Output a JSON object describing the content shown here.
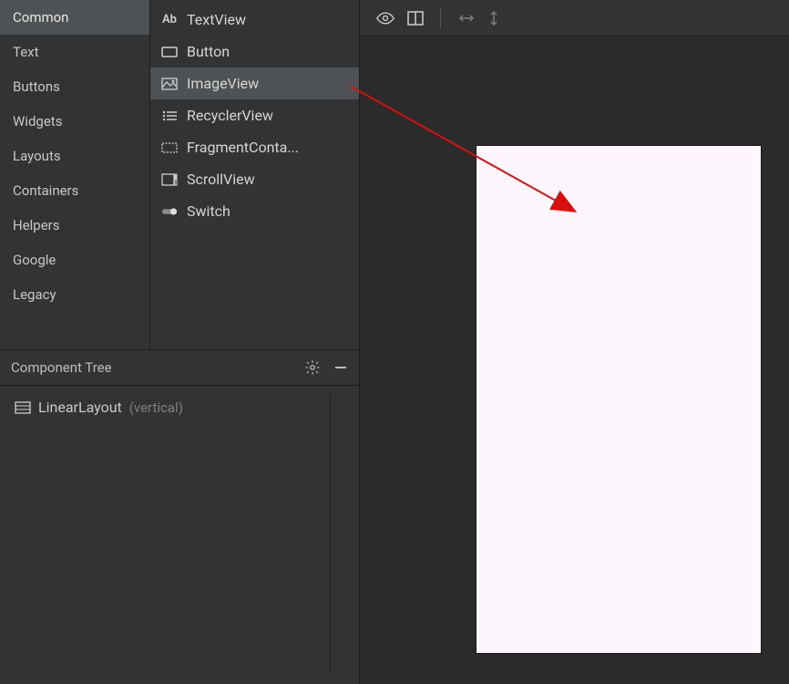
{
  "palette": {
    "categories": [
      {
        "label": "Common",
        "selected": true
      },
      {
        "label": "Text"
      },
      {
        "label": "Buttons"
      },
      {
        "label": "Widgets"
      },
      {
        "label": "Layouts"
      },
      {
        "label": "Containers"
      },
      {
        "label": "Helpers"
      },
      {
        "label": "Google"
      },
      {
        "label": "Legacy"
      }
    ],
    "widgets": [
      {
        "label": "TextView",
        "icon": "text-ab-icon"
      },
      {
        "label": "Button",
        "icon": "button-icon"
      },
      {
        "label": "ImageView",
        "icon": "image-icon",
        "selected": true
      },
      {
        "label": "RecyclerView",
        "icon": "list-icon"
      },
      {
        "label": "FragmentConta...",
        "icon": "fragment-icon"
      },
      {
        "label": "ScrollView",
        "icon": "scroll-icon"
      },
      {
        "label": "Switch",
        "icon": "switch-icon"
      }
    ]
  },
  "component_tree": {
    "title": "Component Tree",
    "root": {
      "label": "LinearLayout",
      "qualifier": "(vertical)"
    }
  },
  "annotation": {
    "arrow_color": "#d80f0f"
  }
}
